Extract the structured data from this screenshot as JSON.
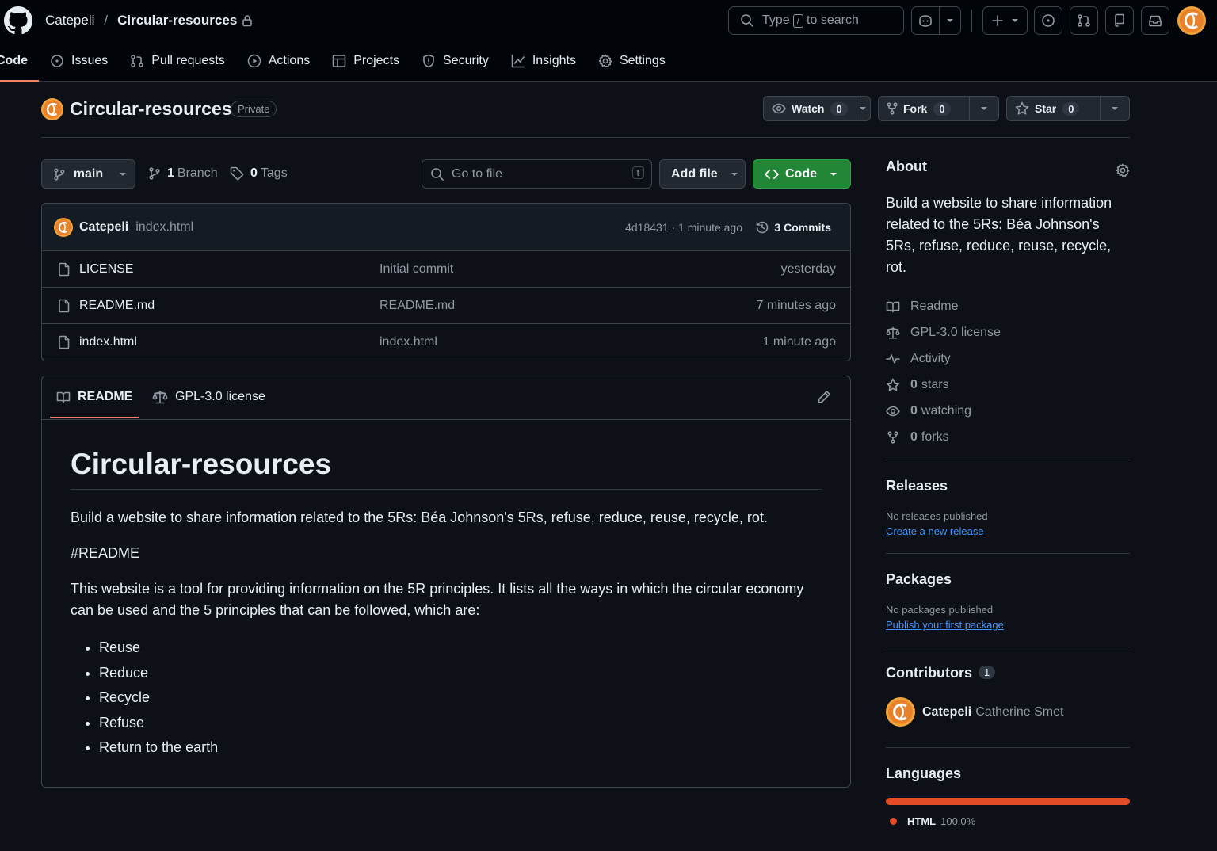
{
  "header": {
    "owner": "Catepeli",
    "separator": "/",
    "repo": "Circular-resources",
    "search": {
      "prefix": "Type",
      "key": "/",
      "suffix": "to search"
    }
  },
  "tabs": [
    {
      "label": "Code",
      "icon": "code-icon"
    },
    {
      "label": "Issues",
      "icon": "issue-icon"
    },
    {
      "label": "Pull requests",
      "icon": "pull-request-icon"
    },
    {
      "label": "Actions",
      "icon": "play-icon"
    },
    {
      "label": "Projects",
      "icon": "table-icon"
    },
    {
      "label": "Security",
      "icon": "shield-icon"
    },
    {
      "label": "Insights",
      "icon": "graph-icon"
    },
    {
      "label": "Settings",
      "icon": "gear-icon"
    }
  ],
  "repo": {
    "title": "Circular-resources",
    "visibility": "Private",
    "watch": {
      "label": "Watch",
      "count": "0"
    },
    "fork": {
      "label": "Fork",
      "count": "0"
    },
    "star": {
      "label": "Star",
      "count": "0"
    }
  },
  "toolbar": {
    "branch": "main",
    "branches_count": "1",
    "branches_label": "Branch",
    "tags_count": "0",
    "tags_label": "Tags",
    "goto_placeholder": "Go to file",
    "goto_key": "t",
    "add_file": "Add file",
    "code": "Code"
  },
  "latest_commit": {
    "author": "Catepeli",
    "message": "index.html",
    "hash_time": "4d18431 · 1 minute ago",
    "commits": "3 Commits"
  },
  "files": [
    {
      "name": "LICENSE",
      "message": "Initial commit",
      "age": "yesterday"
    },
    {
      "name": "README.md",
      "message": "README.md",
      "age": "7 minutes ago"
    },
    {
      "name": "index.html",
      "message": "index.html",
      "age": "1 minute ago"
    }
  ],
  "readme": {
    "tab_readme": "README",
    "tab_license": "GPL-3.0 license",
    "title": "Circular-resources",
    "p1": "Build a website to share information related to the 5Rs: Béa Johnson's 5Rs, refuse, reduce, reuse, recycle, rot.",
    "p2": "#README",
    "p3": "This website is a tool for providing information on the 5R principles. It lists all the ways in which the circular economy can be used and the 5 principles that can be followed, which are:",
    "list": [
      "Reuse",
      "Reduce",
      "Recycle",
      "Refuse",
      "Return to the earth"
    ]
  },
  "about": {
    "title": "About",
    "description": "Build a website to share information related to the 5Rs: Béa Johnson's 5Rs, refuse, reduce, reuse, recycle, rot.",
    "readme": "Readme",
    "license": "GPL-3.0 license",
    "activity": "Activity",
    "stars_count": "0",
    "stars_label": "stars",
    "watching_count": "0",
    "watching_label": "watching",
    "forks_count": "0",
    "forks_label": "forks"
  },
  "releases": {
    "title": "Releases",
    "empty": "No releases published",
    "link": "Create a new release"
  },
  "packages": {
    "title": "Packages",
    "empty": "No packages published",
    "link": "Publish your first package"
  },
  "contributors": {
    "title": "Contributors",
    "count": "1",
    "user": "Catepeli",
    "name": "Catherine Smet"
  },
  "languages": {
    "title": "Languages",
    "name": "HTML",
    "percent": "100.0%",
    "fraction": 1.0,
    "color": "#e34c26"
  }
}
